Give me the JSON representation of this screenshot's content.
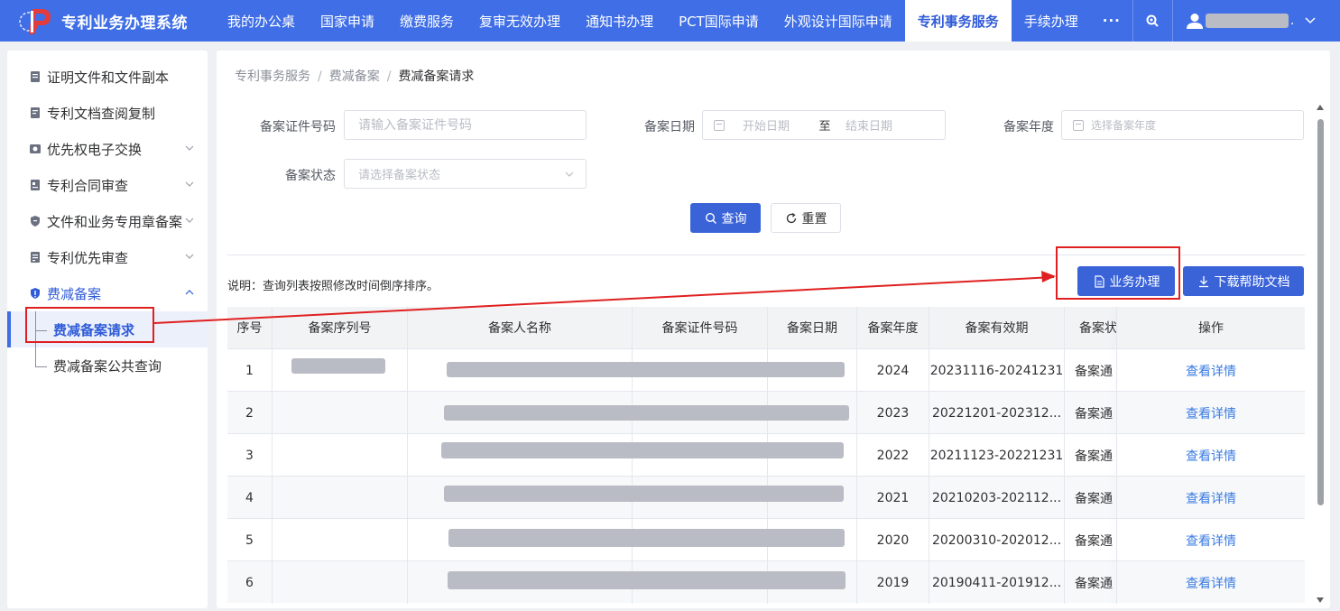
{
  "app": {
    "title": "专利业务办理系统"
  },
  "nav": {
    "items": [
      "我的办公桌",
      "国家申请",
      "缴费服务",
      "复审无效办理",
      "通知书办理",
      "PCT国际申请",
      "外观设计国际申请",
      "专利事务服务",
      "手续办理"
    ],
    "active": "专利事务服务",
    "more": "···"
  },
  "sidebar": {
    "items": [
      {
        "label": "证明文件和文件副本",
        "icon": "document-icon",
        "expandable": false
      },
      {
        "label": "专利文档查阅复制",
        "icon": "document-icon",
        "expandable": false
      },
      {
        "label": "优先权电子交换",
        "icon": "exchange-icon",
        "expandable": true
      },
      {
        "label": "专利合同审查",
        "icon": "contract-icon",
        "expandable": true
      },
      {
        "label": "文件和业务专用章备案",
        "icon": "shield-icon",
        "expandable": true
      },
      {
        "label": "专利优先审查",
        "icon": "review-icon",
        "expandable": true
      },
      {
        "label": "费减备案",
        "icon": "shield-icon",
        "expandable": true,
        "open": true
      }
    ],
    "sub_items": [
      {
        "label": "费减备案请求",
        "active": true
      },
      {
        "label": "费减备案公共查询",
        "active": false
      }
    ]
  },
  "breadcrumb": [
    "专利事务服务",
    "费减备案",
    "费减备案请求"
  ],
  "breadcrumb_sep": "/",
  "form": {
    "cert_label": "备案证件号码",
    "cert_placeholder": "请输入备案证件号码",
    "date_label": "备案日期",
    "date_start": "开始日期",
    "date_to": "至",
    "date_end": "结束日期",
    "year_label": "备案年度",
    "year_placeholder": "选择备案年度",
    "status_label": "备案状态",
    "status_placeholder": "请选择备案状态",
    "query_button": "查询",
    "reset_button": "重置"
  },
  "note": "说明：查询列表按照修改时间倒序排序。",
  "actions": {
    "handle_button": "业务办理",
    "download_button": "下载帮助文档"
  },
  "table": {
    "columns": [
      "序号",
      "备案序列号",
      "备案人名称",
      "备案证件号码",
      "备案日期",
      "备案年度",
      "备案有效期",
      "备案状",
      "操作"
    ],
    "rows": [
      {
        "index": "1",
        "year": "2024",
        "validity": "20231116-20241231",
        "status": "备案通",
        "action": "查看详情"
      },
      {
        "index": "2",
        "year": "2023",
        "validity": "20221201-202312...",
        "status": "备案通",
        "action": "查看详情"
      },
      {
        "index": "3",
        "year": "2022",
        "validity": "20211123-20221231",
        "status": "备案通",
        "action": "查看详情"
      },
      {
        "index": "4",
        "year": "2021",
        "validity": "20210203-202112...",
        "status": "备案通",
        "action": "查看详情"
      },
      {
        "index": "5",
        "year": "2020",
        "validity": "20200310-202012...",
        "status": "备案通",
        "action": "查看详情"
      },
      {
        "index": "6",
        "year": "2019",
        "validity": "20190411-201912...",
        "status": "备案通",
        "action": "查看详情"
      }
    ]
  },
  "colors": {
    "nav_bg": "#3f6ee6",
    "primary": "#3a63d8",
    "link": "#3a7be0",
    "annotation": "#e02020"
  }
}
